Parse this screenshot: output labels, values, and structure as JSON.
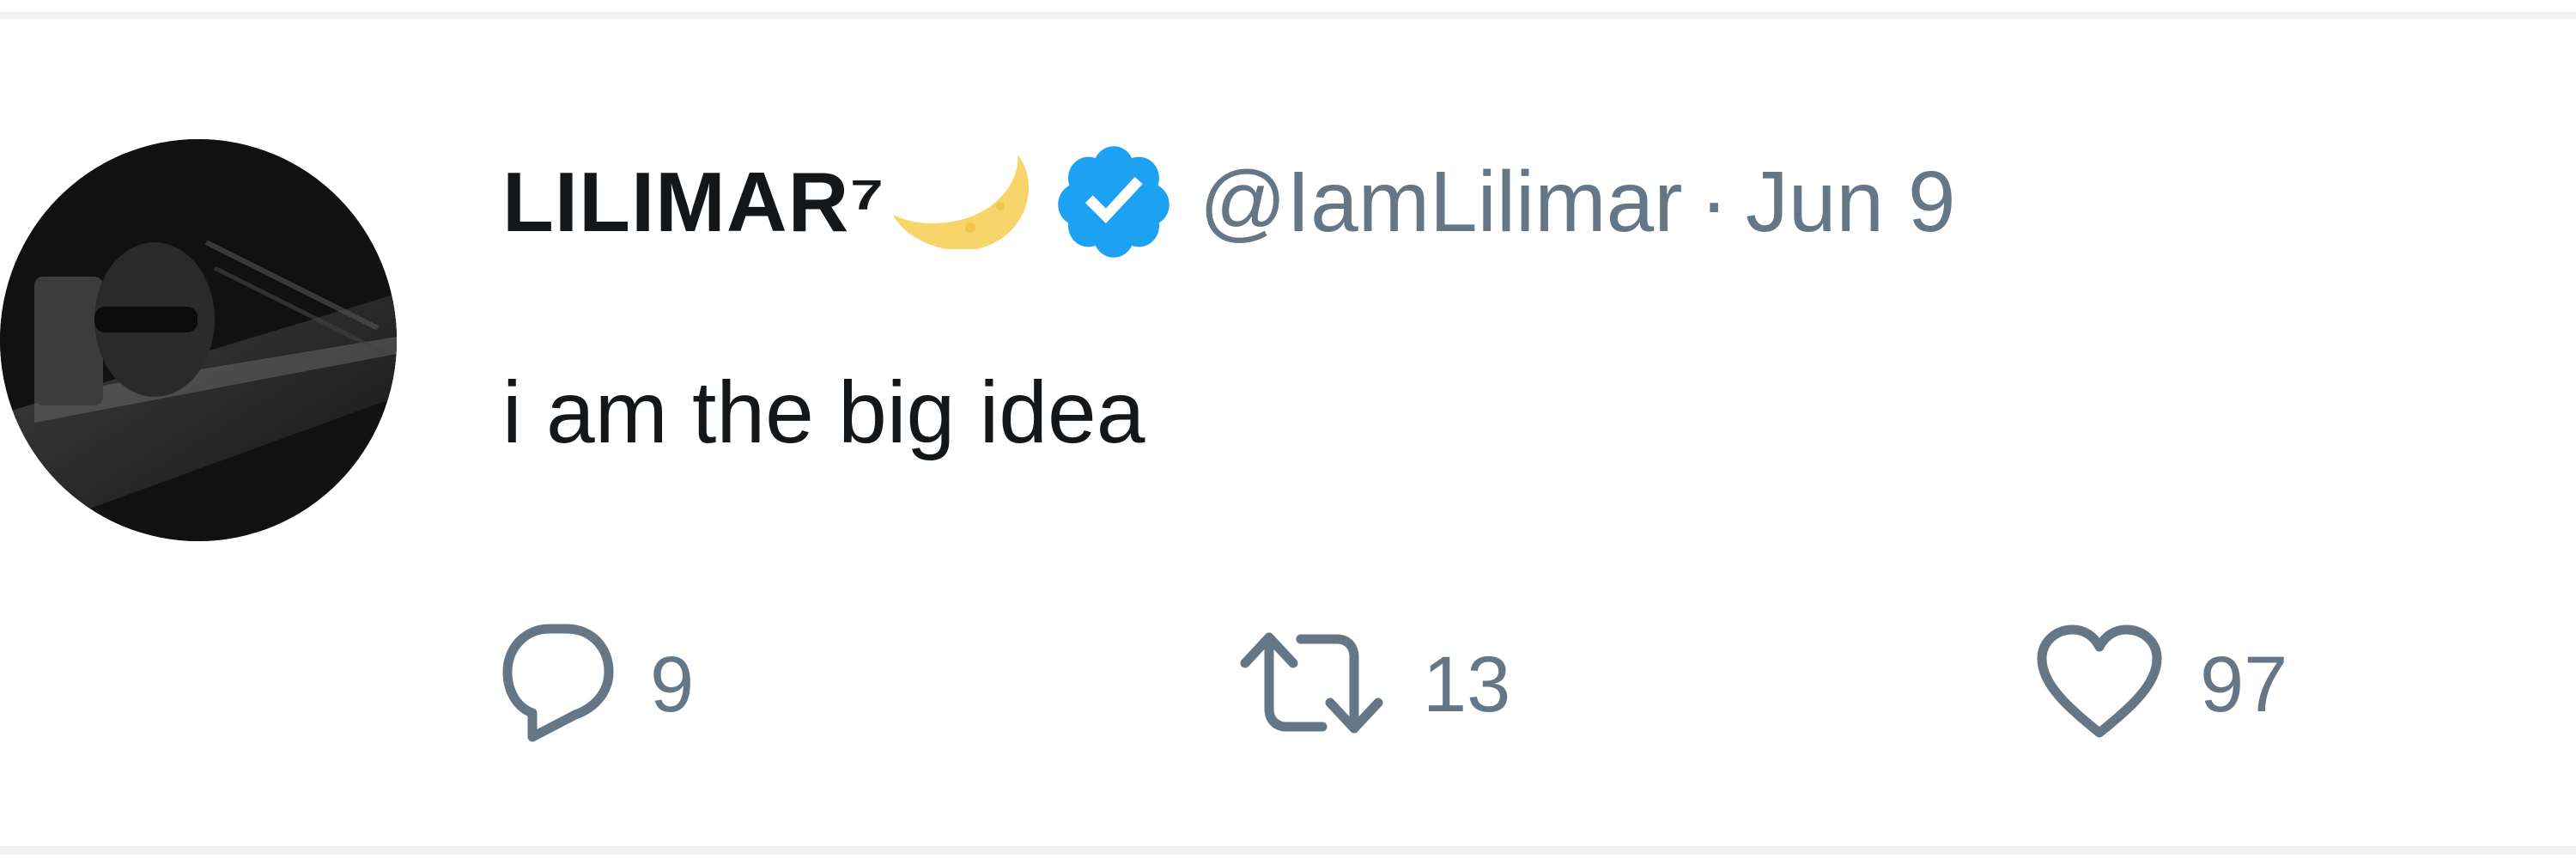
{
  "tweet": {
    "display_name": "LILIMAR⁷",
    "name_emoji": "crescent-moon-icon",
    "verified": true,
    "handle": "@IamLilimar",
    "separator": "·",
    "date": "Jun 9",
    "text": "i am the big idea"
  },
  "actions": {
    "reply_count": "9",
    "retweet_count": "13",
    "like_count": "97"
  },
  "colors": {
    "text_primary": "#14171a",
    "text_secondary": "#657786",
    "verified_blue": "#1da1f2",
    "moon_yellow": "#f7d56a",
    "divider": "#eff1f3"
  }
}
